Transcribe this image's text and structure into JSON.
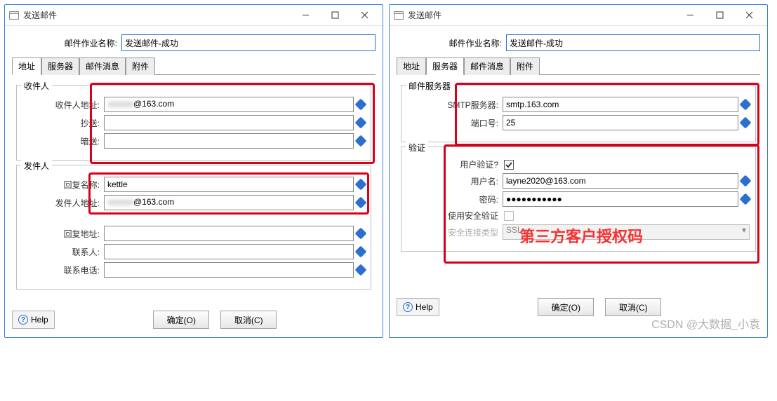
{
  "left": {
    "title": "发送邮件",
    "job_name_label": "邮件作业名称:",
    "job_name_value": "发送邮件-成功",
    "tabs": [
      "地址",
      "服务器",
      "邮件消息",
      "附件"
    ],
    "active_tab": "地址",
    "recipients_legend": "收件人",
    "recipient_addr_label": "收件人地址:",
    "recipient_addr_value": "xxxxxx@163.com",
    "cc_label": "抄送:",
    "cc_value": "",
    "bcc_label": "暗送:",
    "bcc_value": "",
    "sender_legend": "发件人",
    "reply_name_label": "回复名称:",
    "reply_name_value": "kettle",
    "sender_addr_label": "发件人地址:",
    "sender_addr_value": "xxxxxx@163.com",
    "reply_addr_label": "回复地址:",
    "reply_addr_value": "",
    "contact_label": "联系人:",
    "contact_value": "",
    "phone_label": "联系电话:",
    "phone_value": ""
  },
  "right": {
    "title": "发送邮件",
    "job_name_label": "邮件作业名称:",
    "job_name_value": "发送邮件-成功",
    "tabs": [
      "地址",
      "服务器",
      "邮件消息",
      "附件"
    ],
    "active_tab": "服务器",
    "server_legend": "邮件服务器",
    "smtp_label": "SMTP服务器:",
    "smtp_value": "smtp.163.com",
    "port_label": "端口号:",
    "port_value": "25",
    "auth_legend": "验证",
    "user_auth_label": "用户验证?",
    "user_auth_checked": true,
    "username_label": "用户名:",
    "username_value": "layne2020@163.com",
    "password_label": "密码:",
    "password_value": "●●●●●●●●●●●",
    "secure_cb_label": "使用安全验证",
    "secure_type_label": "安全连接类型",
    "secure_type_value": "SSL",
    "annotation": "第三方客户授权码"
  },
  "buttons": {
    "help": "Help",
    "ok": "确定(O)",
    "cancel": "取消(C)"
  },
  "watermark": "CSDN @大数据_小袁"
}
